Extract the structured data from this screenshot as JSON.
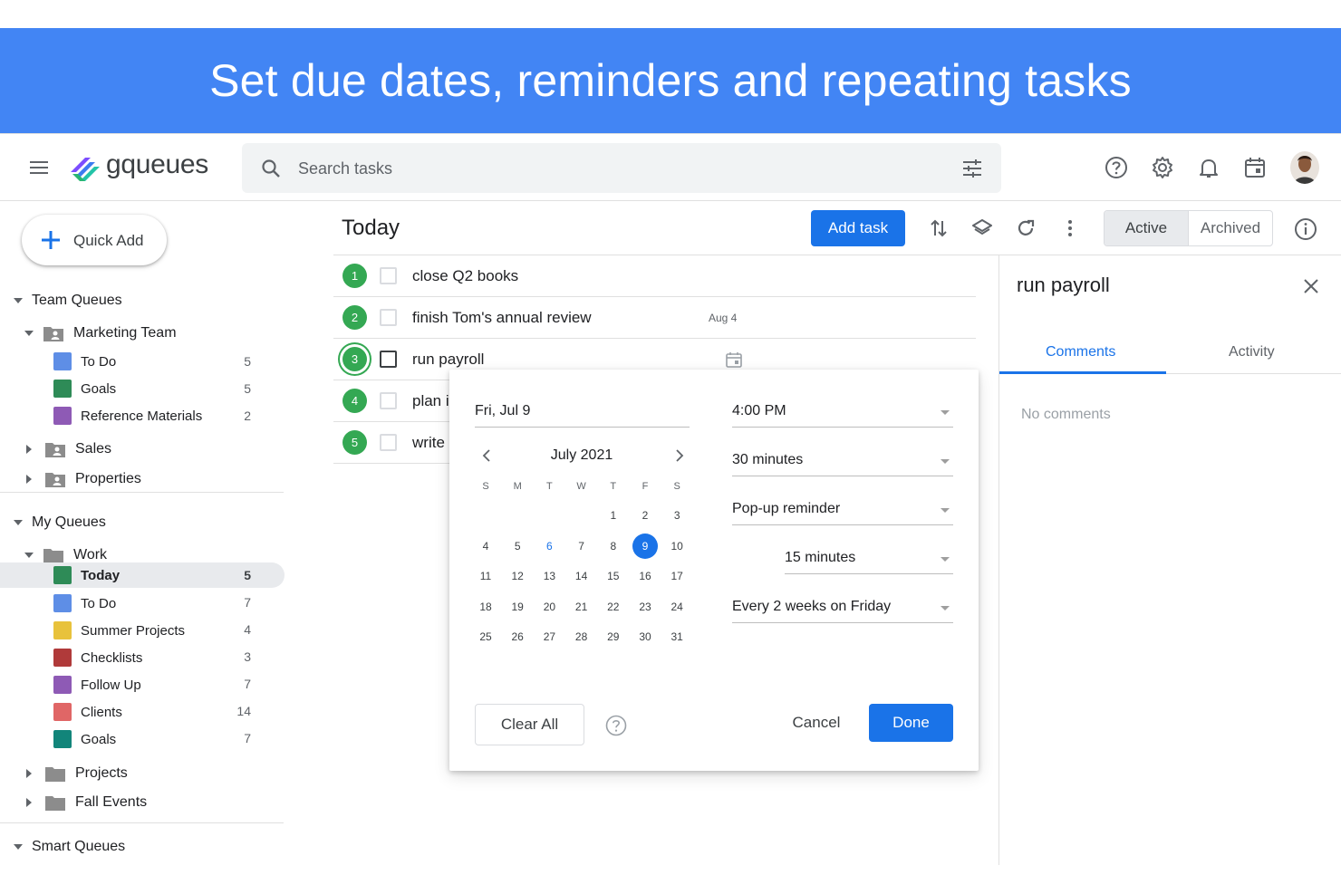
{
  "banner": {
    "title": "Set due dates, reminders and repeating tasks"
  },
  "header": {
    "logo_text": "gqueues",
    "search_placeholder": "Search tasks"
  },
  "sidebar": {
    "quick_add": "Quick Add",
    "team_queues": "Team Queues",
    "marketing_team": "Marketing Team",
    "team_items": [
      {
        "label": "To Do",
        "count": "5",
        "color": "#5e8ee6"
      },
      {
        "label": "Goals",
        "count": "5",
        "color": "#2e8b57"
      },
      {
        "label": "Reference Materials",
        "count": "2",
        "color": "#8e5ab5"
      }
    ],
    "sales": "Sales",
    "properties": "Properties",
    "my_queues": "My Queues",
    "work": "Work",
    "work_items": [
      {
        "label": "Today",
        "count": "5",
        "color": "#2e8b57"
      },
      {
        "label": "To Do",
        "count": "7",
        "color": "#5e8ee6"
      },
      {
        "label": "Summer Projects",
        "count": "4",
        "color": "#e8c23c"
      },
      {
        "label": "Checklists",
        "count": "3",
        "color": "#b03a3a"
      },
      {
        "label": "Follow Up",
        "count": "7",
        "color": "#8e5ab5"
      },
      {
        "label": "Clients",
        "count": "14",
        "color": "#e06666"
      },
      {
        "label": "Goals",
        "count": "7",
        "color": "#12857a"
      }
    ],
    "projects": "Projects",
    "fall_events": "Fall Events",
    "smart_queues": "Smart Queues"
  },
  "main": {
    "title": "Today",
    "add_task": "Add task",
    "active": "Active",
    "archived": "Archived",
    "tasks": [
      {
        "num": "1",
        "title": "close Q2 books",
        "date": ""
      },
      {
        "num": "2",
        "title": "finish Tom's annual review",
        "date": "Aug 4"
      },
      {
        "num": "3",
        "title": "run payroll",
        "date": ""
      },
      {
        "num": "4",
        "title": "plan i",
        "date": ""
      },
      {
        "num": "5",
        "title": "write",
        "date": ""
      }
    ]
  },
  "popup": {
    "date_value": "Fri, Jul 9",
    "month_label": "July 2021",
    "weekdays": [
      "S",
      "M",
      "T",
      "W",
      "T",
      "F",
      "S"
    ],
    "weeks": [
      [
        "",
        "",
        "",
        "",
        "1",
        "2",
        "3"
      ],
      [
        "4",
        "5",
        "6",
        "7",
        "8",
        "9",
        "10"
      ],
      [
        "11",
        "12",
        "13",
        "14",
        "15",
        "16",
        "17"
      ],
      [
        "18",
        "19",
        "20",
        "21",
        "22",
        "23",
        "24"
      ],
      [
        "25",
        "26",
        "27",
        "28",
        "29",
        "30",
        "31"
      ]
    ],
    "today_day": "6",
    "selected_day": "9",
    "time": "4:00 PM",
    "duration": "30 minutes",
    "reminder_type": "Pop-up reminder",
    "reminder_offset": "15 minutes",
    "repeat": "Every 2 weeks on Friday",
    "clear_all": "Clear All",
    "cancel": "Cancel",
    "done": "Done"
  },
  "detail": {
    "title": "run payroll",
    "tab_comments": "Comments",
    "tab_activity": "Activity",
    "no_comments": "No comments"
  },
  "colors": {
    "brand_blue": "#4285f4",
    "primary": "#1a73e8",
    "task_green": "#34a853"
  }
}
